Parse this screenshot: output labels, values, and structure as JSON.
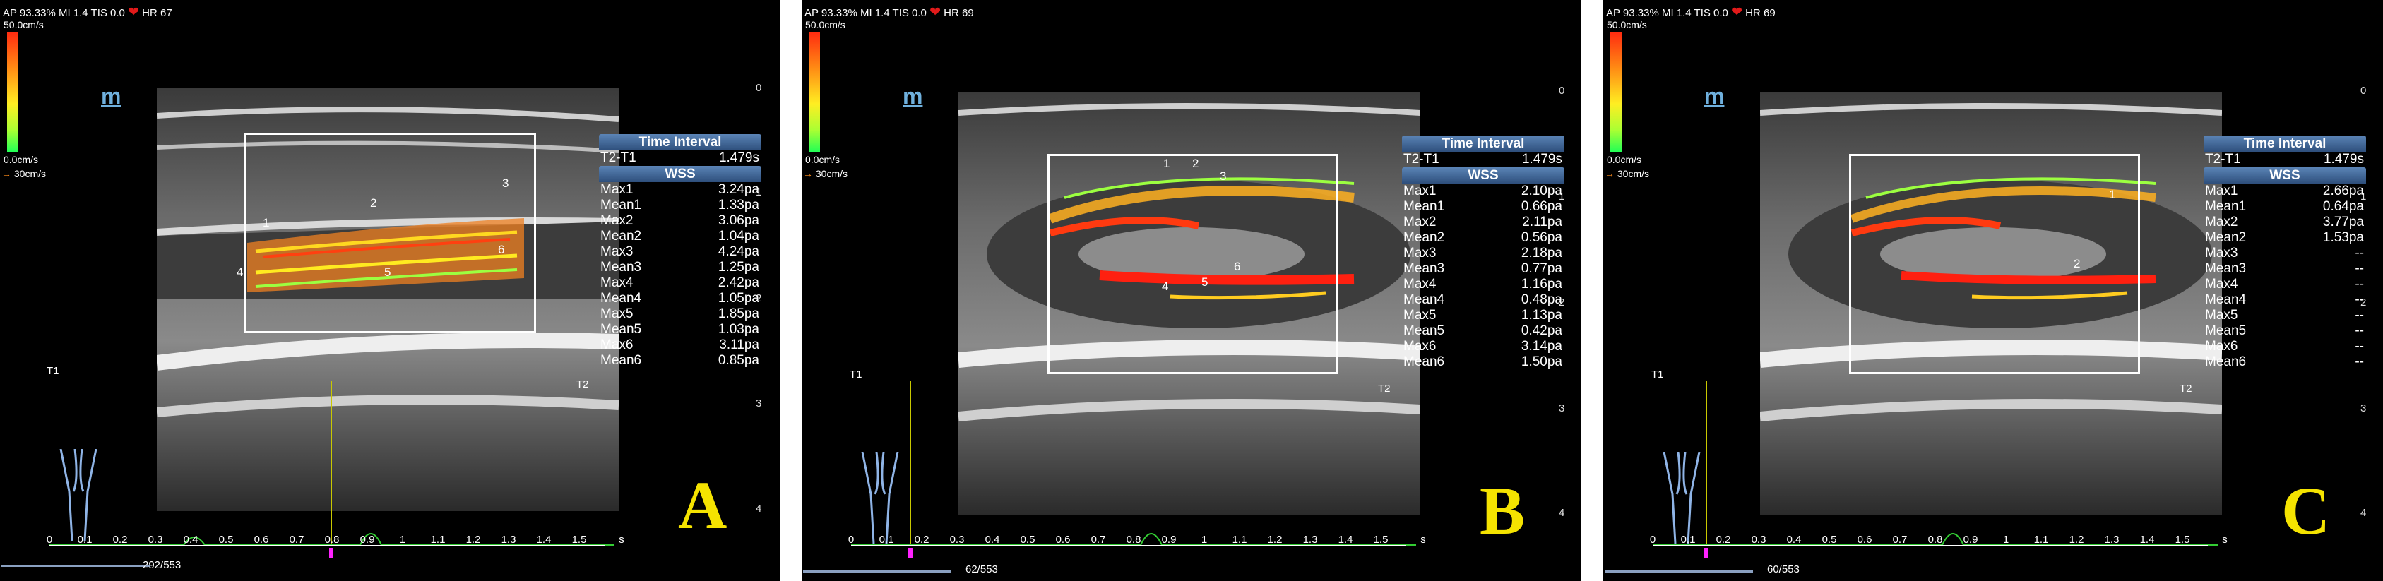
{
  "colors": {
    "heart": "#e21a1a",
    "header": "#3d6496",
    "letter": "#f5e300",
    "roi": "#ffffff"
  },
  "icons": {
    "heart": "heart-icon",
    "arrow": "right-arrow-icon",
    "logo": "m-logo-icon",
    "carotid": "carotid-diagram-icon"
  },
  "panels": [
    {
      "letter": "A",
      "status": {
        "ap": "AP 93.33%",
        "mi": "MI 1.4",
        "tis": "TIS 0.0",
        "heart": "❤",
        "hr": "HR 67"
      },
      "colorbar": {
        "top": "50.0cm/s",
        "bottom": "0.0cm/s"
      },
      "velocity": {
        "arrow": "→",
        "label": "30cm/s"
      },
      "logo": "m",
      "depth": [
        "0",
        "1",
        "2",
        "3",
        "4"
      ],
      "markers": [
        "1",
        "2",
        "3",
        "4",
        "5",
        "6"
      ],
      "time_header": "Time Interval",
      "time_label": "T2-T1",
      "time_value": "1.479s",
      "wss_header": "WSS",
      "rows": [
        {
          "label": "Max1",
          "value": "3.24pa"
        },
        {
          "label": "Mean1",
          "value": "1.33pa"
        },
        {
          "label": "Max2",
          "value": "3.06pa"
        },
        {
          "label": "Mean2",
          "value": "1.04pa"
        },
        {
          "label": "Max3",
          "value": "4.24pa"
        },
        {
          "label": "Mean3",
          "value": "1.25pa"
        },
        {
          "label": "Max4",
          "value": "2.42pa"
        },
        {
          "label": "Mean4",
          "value": "1.05pa"
        },
        {
          "label": "Max5",
          "value": "1.85pa"
        },
        {
          "label": "Mean5",
          "value": "1.03pa"
        },
        {
          "label": "Max6",
          "value": "3.11pa"
        },
        {
          "label": "Mean6",
          "value": "0.85pa"
        }
      ],
      "t1": "T1",
      "t2": "T2",
      "ticks": [
        "0",
        "0.1",
        "0.2",
        "0.3",
        "0.4",
        "0.5",
        "0.6",
        "0.7",
        "0.8",
        "0.9",
        "1",
        "1.1",
        "1.2",
        "1.3",
        "1.4",
        "1.5",
        "s"
      ],
      "frame": "292/553",
      "cursor_fraction": 0.53
    },
    {
      "letter": "B",
      "status": {
        "ap": "AP 93.33%",
        "mi": "MI 1.4",
        "tis": "TIS 0.0",
        "heart": "❤",
        "hr": "HR 69"
      },
      "colorbar": {
        "top": "50.0cm/s",
        "bottom": "0.0cm/s"
      },
      "velocity": {
        "arrow": "→",
        "label": "30cm/s"
      },
      "logo": "m",
      "depth": [
        "0",
        "1",
        "2",
        "3",
        "4"
      ],
      "markers": [
        "1",
        "2",
        "3",
        "4",
        "5",
        "6"
      ],
      "time_header": "Time Interval",
      "time_label": "T2-T1",
      "time_value": "1.479s",
      "wss_header": "WSS",
      "rows": [
        {
          "label": "Max1",
          "value": "2.10pa"
        },
        {
          "label": "Mean1",
          "value": "0.66pa"
        },
        {
          "label": "Max2",
          "value": "2.11pa"
        },
        {
          "label": "Mean2",
          "value": "0.56pa"
        },
        {
          "label": "Max3",
          "value": "2.18pa"
        },
        {
          "label": "Mean3",
          "value": "0.77pa"
        },
        {
          "label": "Max4",
          "value": "1.16pa"
        },
        {
          "label": "Mean4",
          "value": "0.48pa"
        },
        {
          "label": "Max5",
          "value": "1.13pa"
        },
        {
          "label": "Mean5",
          "value": "0.42pa"
        },
        {
          "label": "Max6",
          "value": "3.14pa"
        },
        {
          "label": "Mean6",
          "value": "1.50pa"
        }
      ],
      "t1": "T1",
      "t2": "T2",
      "ticks": [
        "0",
        "0.1",
        "0.2",
        "0.3",
        "0.4",
        "0.5",
        "0.6",
        "0.7",
        "0.8",
        "0.9",
        "1",
        "1.1",
        "1.2",
        "1.3",
        "1.4",
        "1.5",
        "s"
      ],
      "frame": "62/553",
      "cursor_fraction": 0.11
    },
    {
      "letter": "C",
      "status": {
        "ap": "AP 93.33%",
        "mi": "MI 1.4",
        "tis": "TIS 0.0",
        "heart": "❤",
        "hr": "HR 69"
      },
      "colorbar": {
        "top": "50.0cm/s",
        "bottom": "0.0cm/s"
      },
      "velocity": {
        "arrow": "→",
        "label": "30cm/s"
      },
      "logo": "m",
      "depth": [
        "0",
        "1",
        "2",
        "3",
        "4"
      ],
      "markers": [
        "1",
        "2"
      ],
      "time_header": "Time Interval",
      "time_label": "T2-T1",
      "time_value": "1.479s",
      "wss_header": "WSS",
      "rows": [
        {
          "label": "Max1",
          "value": "2.66pa"
        },
        {
          "label": "Mean1",
          "value": "0.64pa"
        },
        {
          "label": "Max2",
          "value": "3.77pa"
        },
        {
          "label": "Mean2",
          "value": "1.53pa"
        },
        {
          "label": "Max3",
          "value": "--"
        },
        {
          "label": "Mean3",
          "value": "--"
        },
        {
          "label": "Max4",
          "value": "--"
        },
        {
          "label": "Mean4",
          "value": "--"
        },
        {
          "label": "Max5",
          "value": "--"
        },
        {
          "label": "Mean5",
          "value": "--"
        },
        {
          "label": "Max6",
          "value": "--"
        },
        {
          "label": "Mean6",
          "value": "--"
        }
      ],
      "t1": "T1",
      "t2": "T2",
      "ticks": [
        "0",
        "0.1",
        "0.2",
        "0.3",
        "0.4",
        "0.5",
        "0.6",
        "0.7",
        "0.8",
        "0.9",
        "1",
        "1.1",
        "1.2",
        "1.3",
        "1.4",
        "1.5",
        "s"
      ],
      "frame": "60/553",
      "cursor_fraction": 0.1
    }
  ]
}
